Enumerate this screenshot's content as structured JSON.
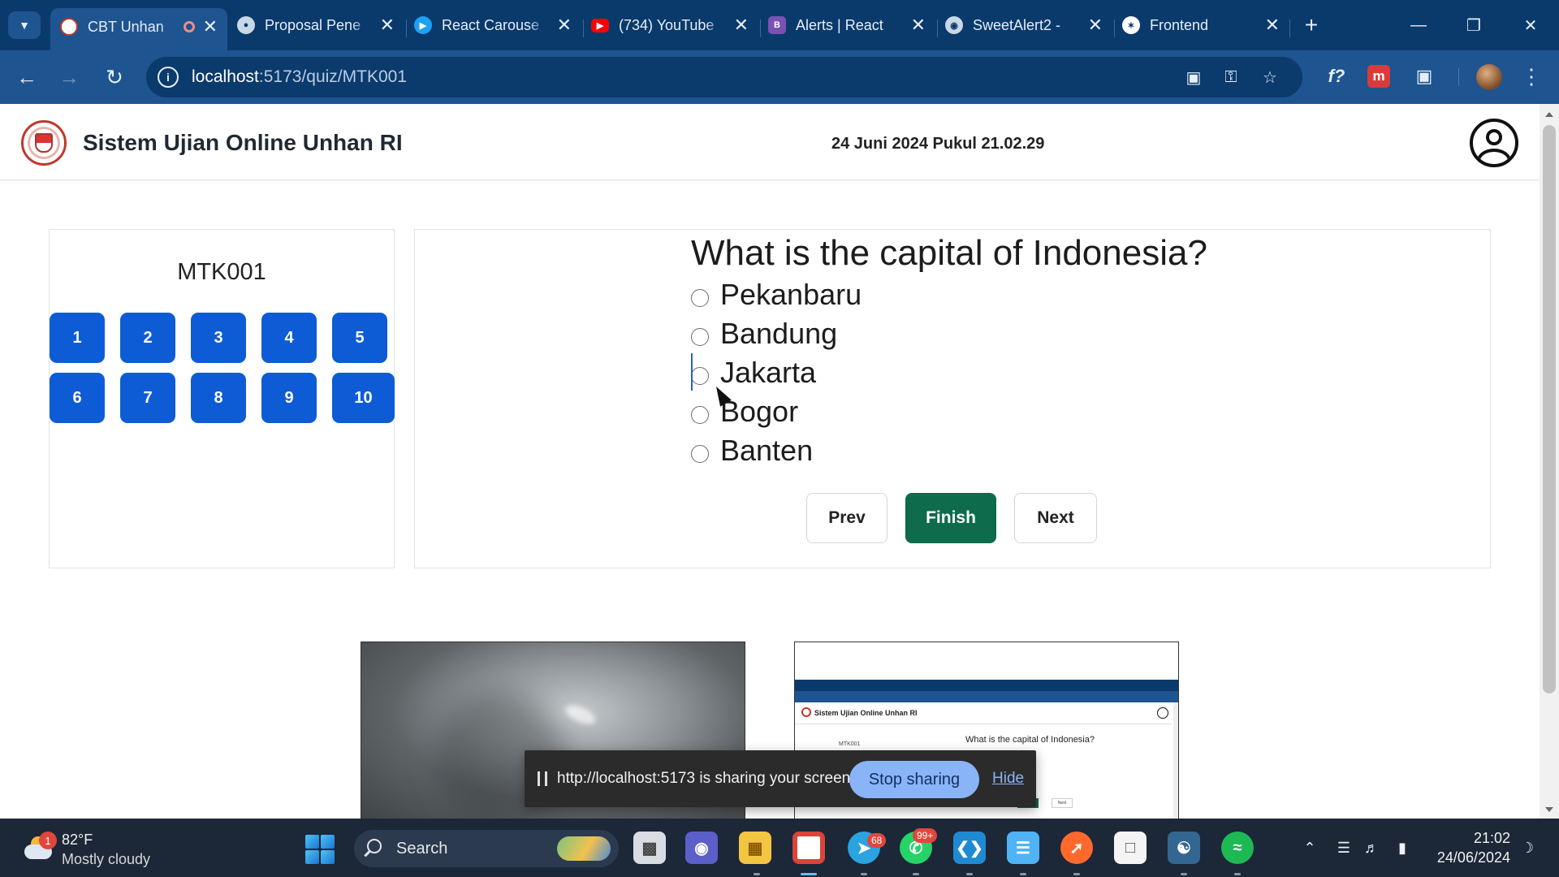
{
  "browser": {
    "tabs": [
      {
        "label": "CBT Unhan",
        "favicon_color": "#ffffff",
        "recording": true,
        "active": true
      },
      {
        "label": "Proposal Pene",
        "favicon_color": "#c9d7e6"
      },
      {
        "label": "React Carouse",
        "favicon_color": "#1da1f2"
      },
      {
        "label": "(734) YouTube",
        "favicon_color": "#ff0000"
      },
      {
        "label": "Alerts | React",
        "favicon_color": "#7952b3"
      },
      {
        "label": "SweetAlert2 -",
        "favicon_color": "#c9d7e6"
      },
      {
        "label": "Frontend",
        "favicon_color": "#ffffff"
      }
    ],
    "url_host": "localhost",
    "url_path": ":5173/quiz/MTK001",
    "extension_f_label": "f?",
    "extension_m_label": "m"
  },
  "header": {
    "title": "Sistem Ujian Online Unhan RI",
    "datetime": "24 Juni 2024 Pukul 21.02.29"
  },
  "quiz": {
    "code": "MTK001",
    "question_numbers": [
      "1",
      "2",
      "3",
      "4",
      "5",
      "6",
      "7",
      "8",
      "9",
      "10"
    ],
    "question": "What is the capital of Indonesia?",
    "options": [
      "Pekanbaru",
      "Bandung",
      "Jakarta",
      "Bogor",
      "Banten"
    ],
    "buttons": {
      "prev": "Prev",
      "finish": "Finish",
      "next": "Next"
    }
  },
  "screen_preview": {
    "title": "Sistem Ujian Online Unhan RI",
    "question": "What is the capital of Indonesia?",
    "code": "MTK001",
    "next": "Next"
  },
  "share_bar": {
    "message": "http://localhost:5173 is sharing your screen.",
    "stop_label": "Stop sharing",
    "hide_label": "Hide"
  },
  "taskbar": {
    "weather_badge": "1",
    "temperature": "82°F",
    "weather": "Mostly cloudy",
    "search_placeholder": "Search",
    "telegram_badge": "68",
    "whatsapp_badge": "99+",
    "time": "21:02",
    "date": "24/06/2024"
  },
  "colors": {
    "tabbar": "#0a3a6b",
    "toolbar": "#1e5490",
    "question_button": "#0d5cd6",
    "finish_button": "#0e6b4b",
    "stop_sharing": "#8ab4f8",
    "taskbar": "#1c2738"
  }
}
